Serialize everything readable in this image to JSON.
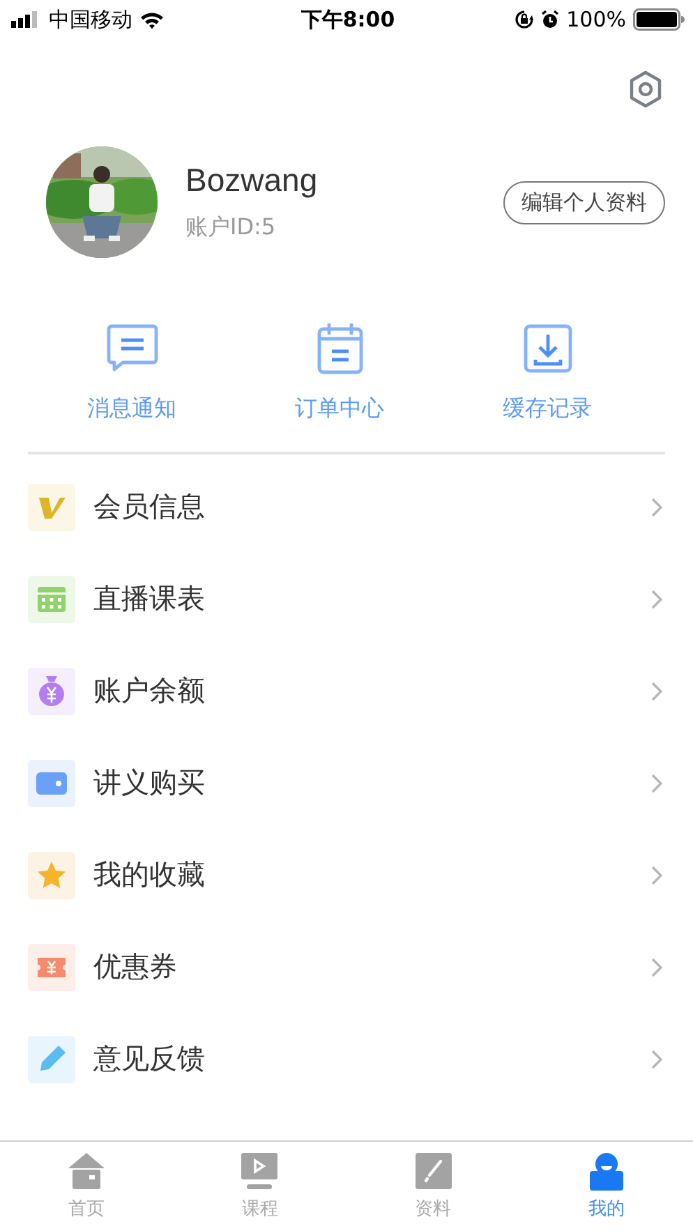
{
  "status_bar": {
    "carrier": "中国移动",
    "time": "下午8:00",
    "battery": "100%"
  },
  "profile": {
    "name": "Bozwang",
    "account_id": "账户ID:5",
    "edit_button": "编辑个人资料"
  },
  "quick_actions": [
    {
      "label": "消息通知",
      "kind": "message"
    },
    {
      "label": "订单中心",
      "kind": "calendar"
    },
    {
      "label": "缓存记录",
      "kind": "download"
    }
  ],
  "menu": [
    {
      "label": "会员信息",
      "kind": "vip"
    },
    {
      "label": "直播课表",
      "kind": "schedule"
    },
    {
      "label": "账户余额",
      "kind": "moneybag"
    },
    {
      "label": "讲义购买",
      "kind": "wallet"
    },
    {
      "label": "我的收藏",
      "kind": "star"
    },
    {
      "label": "优惠券",
      "kind": "coupon"
    },
    {
      "label": "意见反馈",
      "kind": "feedback"
    }
  ],
  "tabs": [
    {
      "label": "首页",
      "kind": "home",
      "selected": false
    },
    {
      "label": "课程",
      "kind": "course",
      "selected": false
    },
    {
      "label": "资料",
      "kind": "material",
      "selected": false
    },
    {
      "label": "我的",
      "kind": "me",
      "selected": true
    }
  ]
}
